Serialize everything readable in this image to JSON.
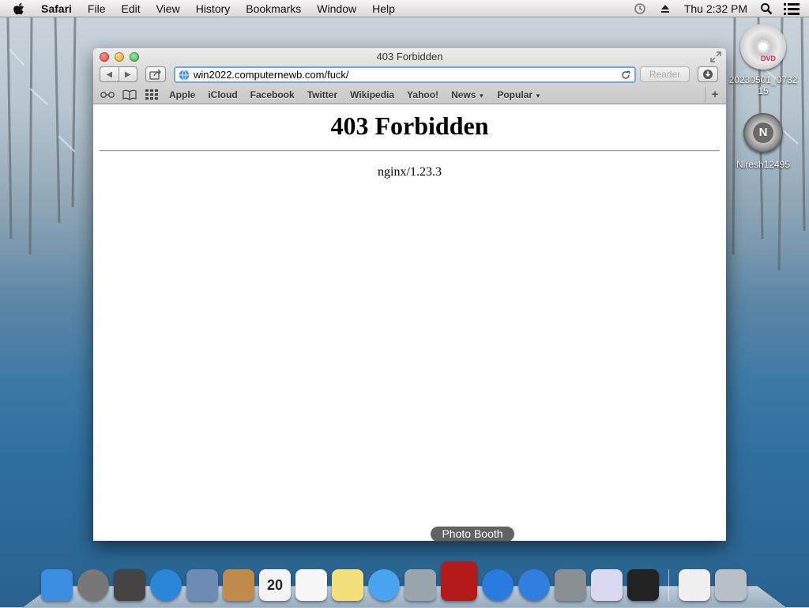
{
  "menubar": {
    "app_name": "Safari",
    "menus": [
      "File",
      "Edit",
      "View",
      "History",
      "Bookmarks",
      "Window",
      "Help"
    ],
    "clock": "Thu 2:32 PM",
    "icons": [
      "apple-icon",
      "time-machine-icon",
      "eject-icon",
      "spotlight-icon",
      "notification-center-icon"
    ]
  },
  "desktop": {
    "icons": [
      {
        "label": "20230501_073215",
        "icon": "dvd-icon",
        "badge": "DVD"
      },
      {
        "label": "Niresh12495",
        "icon": "hard-disk-icon",
        "badge": "N"
      }
    ]
  },
  "window": {
    "title": "403 Forbidden",
    "url": "win2022.computernewb.com/fuck/",
    "reader_label": "Reader",
    "bookmarks": [
      {
        "label": "Apple",
        "has_menu": false
      },
      {
        "label": "iCloud",
        "has_menu": false
      },
      {
        "label": "Facebook",
        "has_menu": false
      },
      {
        "label": "Twitter",
        "has_menu": false
      },
      {
        "label": "Wikipedia",
        "has_menu": false
      },
      {
        "label": "Yahoo!",
        "has_menu": false
      },
      {
        "label": "News",
        "has_menu": true
      },
      {
        "label": "Popular",
        "has_menu": true
      }
    ],
    "new_tab_label": "+"
  },
  "page": {
    "heading": "403 Forbidden",
    "server": "nginx/1.23.3"
  },
  "dock": {
    "tooltip": "Photo Booth",
    "apps": [
      {
        "name": "finder",
        "color": "#3c8fe0"
      },
      {
        "name": "launchpad",
        "color": "#777"
      },
      {
        "name": "mission-control",
        "color": "#444"
      },
      {
        "name": "safari",
        "color": "#2a87d8"
      },
      {
        "name": "mail",
        "color": "#6d8bb5"
      },
      {
        "name": "contacts",
        "color": "#c08a4a"
      },
      {
        "name": "calendar",
        "color": "#f3f3f3",
        "text": "20"
      },
      {
        "name": "reminders",
        "color": "#f7f7f7"
      },
      {
        "name": "notes",
        "color": "#f4e07a"
      },
      {
        "name": "messages",
        "color": "#4aa3f0"
      },
      {
        "name": "facetime",
        "color": "#9aa6ae"
      },
      {
        "name": "photo-booth",
        "color": "#b31b1b"
      },
      {
        "name": "itunes",
        "color": "#2a7be0"
      },
      {
        "name": "app-store",
        "color": "#2f7ee0"
      },
      {
        "name": "system-preferences",
        "color": "#8a8f94"
      },
      {
        "name": "script-wizard",
        "color": "#d9d9f2"
      },
      {
        "name": "terminal",
        "color": "#222"
      },
      {
        "name": "documents",
        "color": "#f0f0f0"
      },
      {
        "name": "trash",
        "color": "#b8bfc5"
      }
    ]
  }
}
